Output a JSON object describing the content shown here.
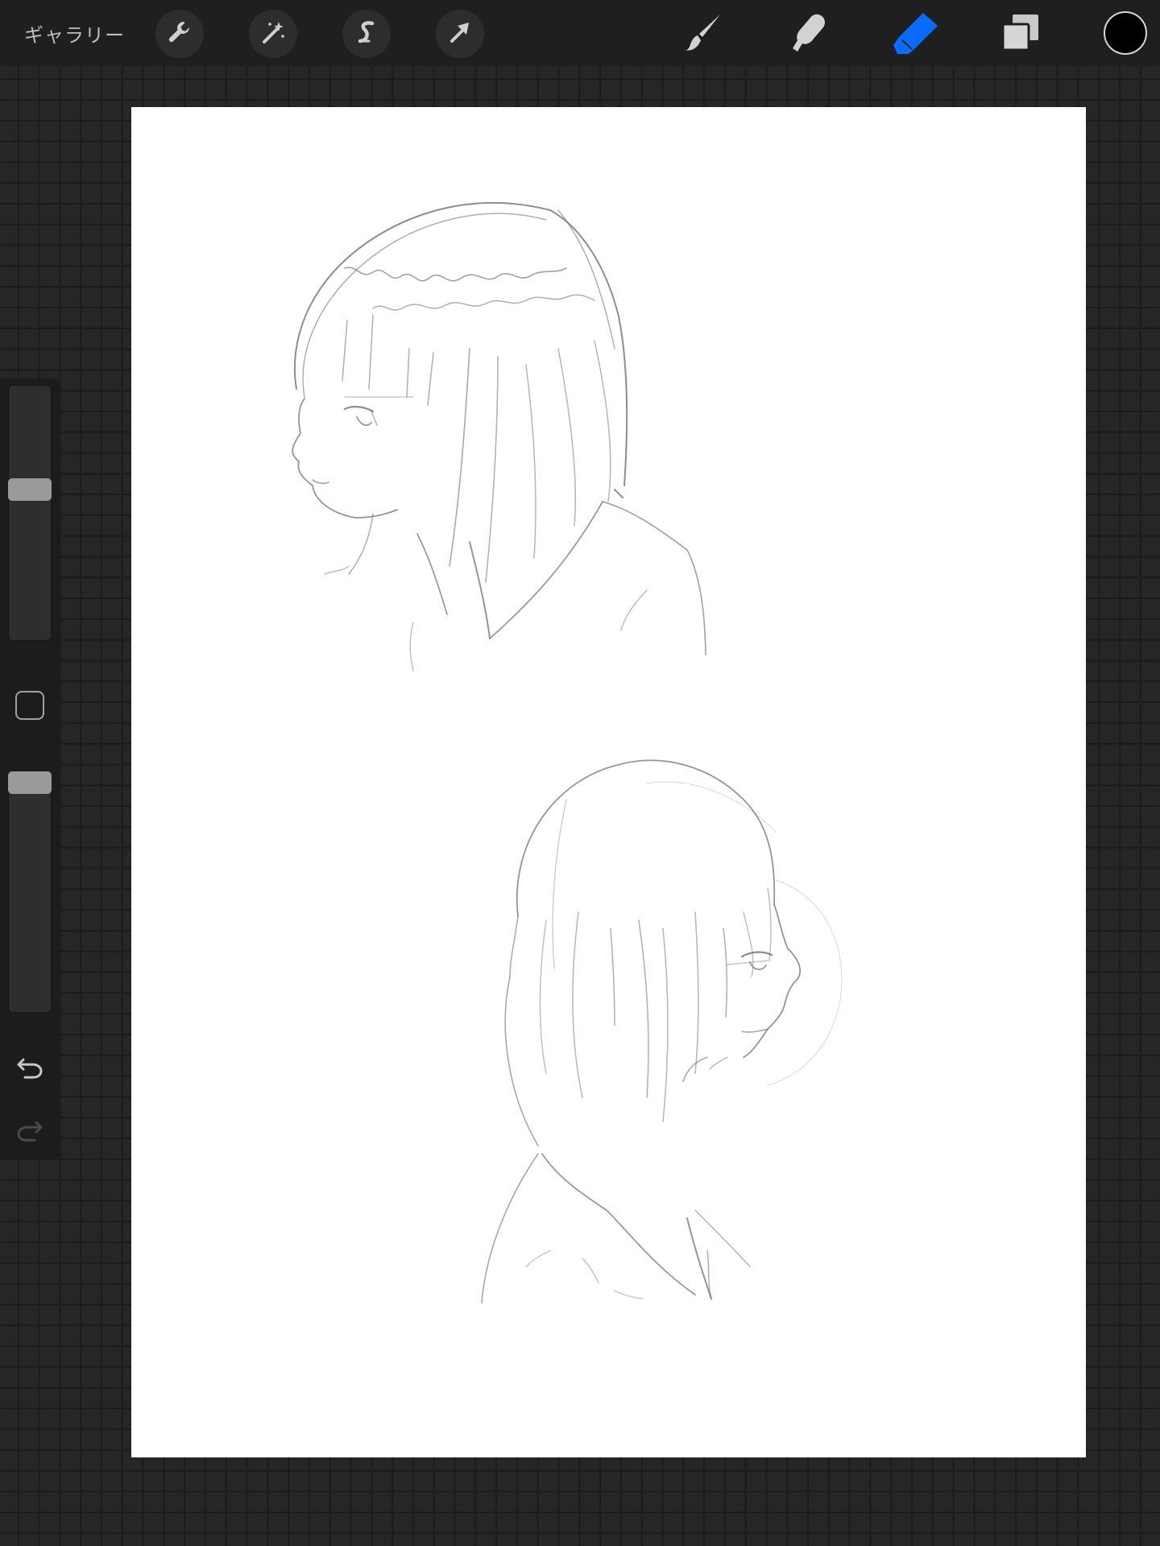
{
  "topbar": {
    "gallery_label": "ギャラリー",
    "left_tools": [
      {
        "name": "actions",
        "icon": "wrench-icon"
      },
      {
        "name": "adjustments",
        "icon": "magic-wand-icon"
      },
      {
        "name": "selection",
        "icon": "selection-s-icon"
      },
      {
        "name": "transform",
        "icon": "arrow-cursor-icon"
      }
    ],
    "right_tools": [
      {
        "name": "brush",
        "icon": "brush-icon",
        "active": false
      },
      {
        "name": "smudge",
        "icon": "smudge-finger-icon",
        "active": false
      },
      {
        "name": "eraser",
        "icon": "eraser-icon",
        "active": true
      },
      {
        "name": "layers",
        "icon": "layers-icon",
        "active": false
      }
    ],
    "current_color": "#000000",
    "active_accent": "#0a6cff"
  },
  "sidebar": {
    "brush_size_level": 0.6,
    "opacity_level": 1.0,
    "modify_button_icon": "square-outline-icon",
    "undo_icon": "undo-icon",
    "redo_icon": "redo-icon",
    "redo_enabled": false
  },
  "canvas": {
    "background": "#ffffff",
    "content": "pencil-sketch-two-girl-profiles"
  }
}
